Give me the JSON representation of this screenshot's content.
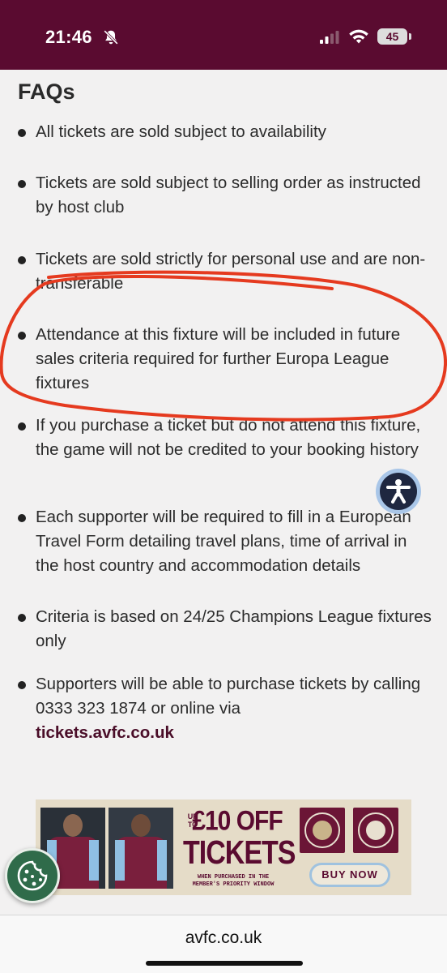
{
  "status_bar": {
    "time": "21:46",
    "battery": "45",
    "icons": [
      "bell-slash-icon",
      "cellular-signal-icon",
      "wifi-icon",
      "battery-icon"
    ],
    "background_color": "#5a0b30"
  },
  "faq": {
    "title": "FAQs",
    "items": [
      "All tickets are sold subject to availability",
      "Tickets are sold subject to selling order as instructed by host club",
      "Tickets are sold strictly for personal use and are non-transferable",
      "Attendance at this fixture will be included in future sales criteria required for further Europa League fixtures",
      "If you purchase a ticket but do not attend this fixture, the game will not be credited to your booking history",
      "Each supporter will be required to fill in a European Travel Form detailing travel plans, time of arrival in the host country and accommodation details",
      "Criteria is based on 24/25 Champions League fixtures only",
      "Supporters will be able to purchase tickets by calling 0333 323 1874 or online via"
    ],
    "link_text": "tickets.avfc.co.uk"
  },
  "annotation_color": "#e53a1f",
  "banner": {
    "up_to": "UP TO",
    "amount": "£10 OFF",
    "headline": "TICKETS",
    "note": "WHEN PURCHASED IN THE MEMBER'S PRIORITY WINDOW",
    "button": "BUY NOW",
    "accent_color": "#5a0b30"
  },
  "accessibility_icon": "accessibility-person-icon",
  "cookie_icon": "cookie-icon",
  "browser": {
    "url": "avfc.co.uk"
  }
}
